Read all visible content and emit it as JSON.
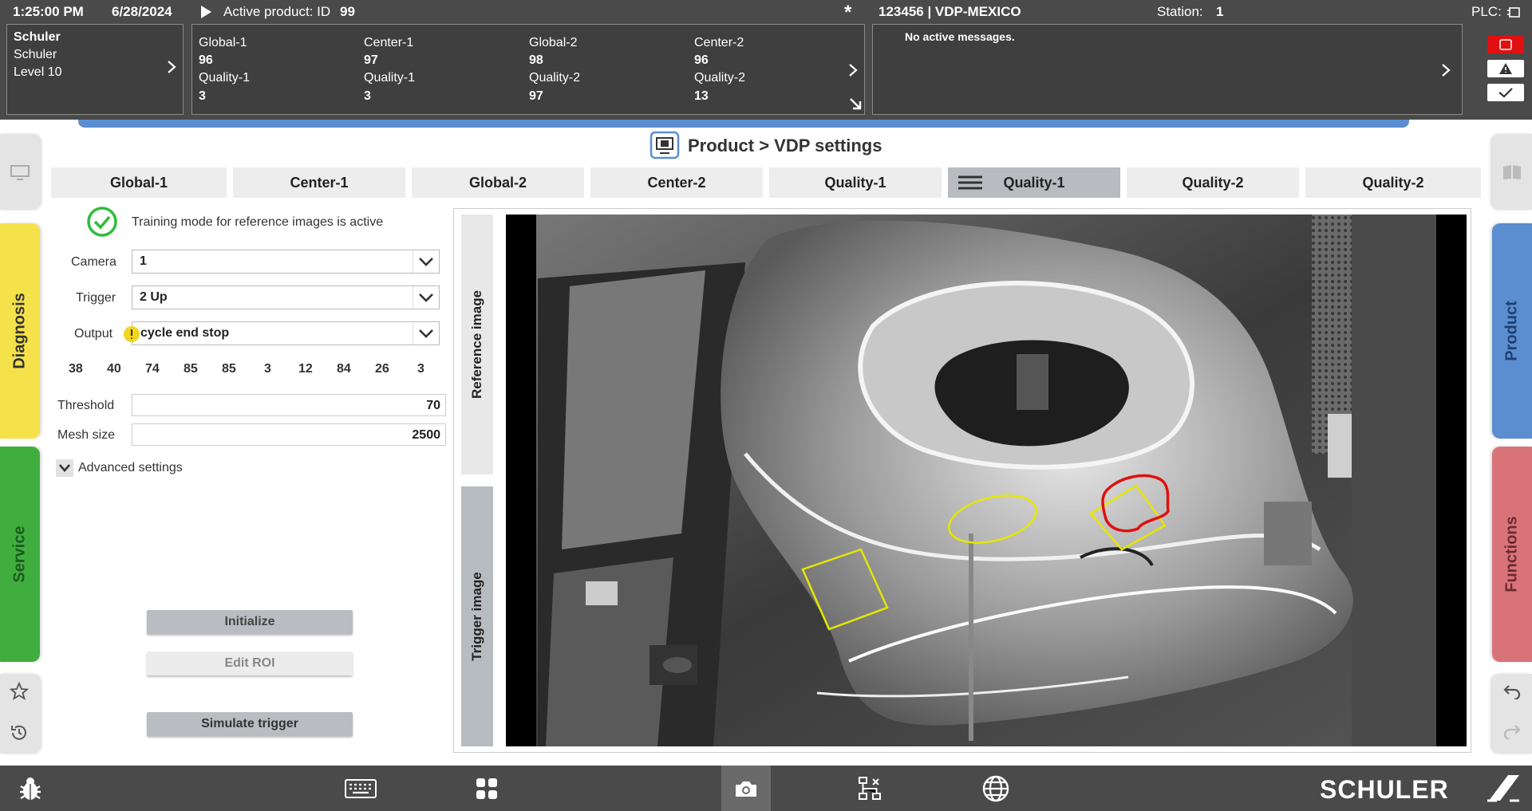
{
  "topbar": {
    "time": "1:25:00 PM",
    "date": "6/28/2024",
    "active_product_label": "Active product: ID",
    "active_product_id": "99",
    "asterisk": "*",
    "machine": "123456 | VDP-MEXICO",
    "station_label": "Station:",
    "station_value": "1",
    "plc_label": "PLC:"
  },
  "user_panel": {
    "name": "Schuler",
    "org": "Schuler",
    "level": "Level 10"
  },
  "counters": [
    {
      "label": "Global-1",
      "value": "96"
    },
    {
      "label": "Center-1",
      "value": "97"
    },
    {
      "label": "Global-2",
      "value": "98"
    },
    {
      "label": "Center-2",
      "value": "96"
    },
    {
      "label": "Quality-1",
      "value": "3"
    },
    {
      "label": "Quality-1",
      "value": "3"
    },
    {
      "label": "Quality-2",
      "value": "97"
    },
    {
      "label": "Quality-2",
      "value": "13"
    }
  ],
  "messages": {
    "text": "No active messages."
  },
  "sidetabs": {
    "diagnosis": "Diagnosis",
    "service": "Service",
    "product": "Product",
    "functions": "Functions"
  },
  "header": {
    "breadcrumb": "Product > VDP settings"
  },
  "tabs": [
    "Global-1",
    "Center-1",
    "Global-2",
    "Center-2",
    "Quality-1",
    "Quality-1",
    "Quality-2",
    "Quality-2"
  ],
  "form": {
    "training_text": "Training mode for reference images is active",
    "camera_label": "Camera",
    "camera_value": "1",
    "trigger_label": "Trigger",
    "trigger_value": "2 Up",
    "output_label": "Output",
    "output_value": "cycle end stop",
    "numbers": [
      "38",
      "40",
      "74",
      "85",
      "85",
      "3",
      "12",
      "84",
      "26",
      "3"
    ],
    "threshold_label": "Threshold",
    "threshold_value": "70",
    "mesh_label": "Mesh size",
    "mesh_value": "2500",
    "advanced_label": "Advanced settings"
  },
  "buttons": {
    "initialize": "Initialize",
    "edit_roi": "Edit ROI",
    "simulate": "Simulate trigger"
  },
  "image_tabs": {
    "reference": "Reference image",
    "trigger": "Trigger image"
  },
  "brand": "SCHULER",
  "colors": {
    "bar": "#4a4a4a",
    "accent_blue": "#5b8ed0",
    "diagnosis": "#f5e24a",
    "service": "#3fae3f",
    "product": "#5b8ed0",
    "functions": "#d9737a",
    "roi_yellow": "#e6e600",
    "roi_red": "#e01010",
    "ok_green": "#2ebd3a"
  }
}
